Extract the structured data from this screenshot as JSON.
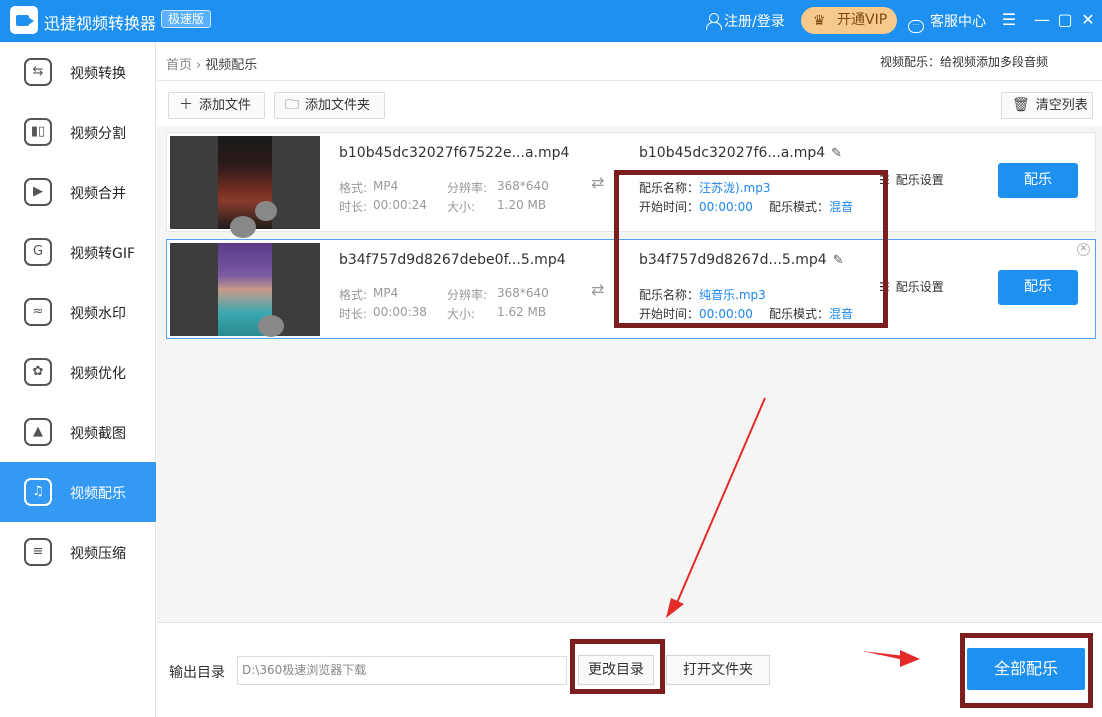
{
  "app": {
    "title": "迅捷视频转换器",
    "edition": "极速版",
    "login": "注册/登录",
    "vip": "开通VIP",
    "vip_icon": "crown-icon",
    "service": "客服中心",
    "brand_color": "#1e90f0"
  },
  "sidebar": {
    "items": [
      {
        "label": "视频转换",
        "icon": "convert-icon",
        "glyph": "⇆"
      },
      {
        "label": "视频分割",
        "icon": "split-icon",
        "glyph": "▮▯"
      },
      {
        "label": "视频合并",
        "icon": "merge-icon",
        "glyph": "▶"
      },
      {
        "label": "视频转GIF",
        "icon": "gif-icon",
        "glyph": "G"
      },
      {
        "label": "视频水印",
        "icon": "watermark-icon",
        "glyph": "≈"
      },
      {
        "label": "视频优化",
        "icon": "optimize-icon",
        "glyph": "✿"
      },
      {
        "label": "视频截图",
        "icon": "screenshot-icon",
        "glyph": "▲"
      },
      {
        "label": "视频配乐",
        "icon": "music-icon",
        "glyph": "♫"
      },
      {
        "label": "视频压缩",
        "icon": "compress-icon",
        "glyph": "≡"
      }
    ],
    "active_index": 7
  },
  "breadcrumb": {
    "home": "首页",
    "current": "视频配乐"
  },
  "page_desc": "视频配乐：给视频添加多段音频",
  "toolbar": {
    "add_file": "添加文件",
    "add_folder": "添加文件夹",
    "clear_list": "清空列表"
  },
  "files": [
    {
      "name": "b10b45dc32027f67522e...a.mp4",
      "format_label": "格式:",
      "format": "MP4",
      "resolution_label": "分辨率:",
      "resolution": "368*640",
      "duration_label": "时长:",
      "duration": "00:00:24",
      "size_label": "大小:",
      "size": "1.20 MB",
      "output_name": "b10b45dc32027f6...a.mp4",
      "music_name_label": "配乐名称：",
      "music_name": "汪苏泷).mp3",
      "start_label": "开始时间：",
      "start": "00:00:00",
      "mode_label": "配乐模式：",
      "mode": "混音",
      "settings": "配乐设置",
      "action": "配乐"
    },
    {
      "name": "b34f757d9d8267debe0f...5.mp4",
      "format_label": "格式:",
      "format": "MP4",
      "resolution_label": "分辨率:",
      "resolution": "368*640",
      "duration_label": "时长:",
      "duration": "00:00:38",
      "size_label": "大小:",
      "size": "1.62 MB",
      "output_name": "b34f757d9d8267d...5.mp4",
      "music_name_label": "配乐名称：",
      "music_name": "纯音乐.mp3",
      "start_label": "开始时间：",
      "start": "00:00:00",
      "mode_label": "配乐模式：",
      "mode": "混音",
      "settings": "配乐设置",
      "action": "配乐"
    }
  ],
  "output": {
    "label": "输出目录",
    "path": "D:\\360极速浏览器下载",
    "change_dir": "更改目录",
    "open_folder": "打开文件夹",
    "all_action": "全部配乐"
  }
}
